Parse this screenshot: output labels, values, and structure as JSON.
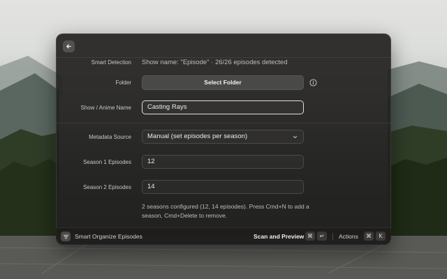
{
  "smart_detection": {
    "label": "Smart Detection",
    "value": "Show name: \"Episode\" · 26/26 episodes detected"
  },
  "folder": {
    "label": "Folder",
    "button_label": "Select Folder",
    "info_icon": "info-circle-icon"
  },
  "show_name": {
    "label": "Show / Anime Name",
    "value": "Casting Rays"
  },
  "metadata_source": {
    "label": "Metadata Source",
    "selected": "Manual (set episodes per season)"
  },
  "season1": {
    "label": "Season 1 Episodes",
    "value": "12"
  },
  "season2": {
    "label": "Season 2 Episodes",
    "value": "14"
  },
  "help_text": "2 seasons configured (12, 14 episodes). Press Cmd+N to add a season, Cmd+Delete to remove.",
  "footer": {
    "app_icon": "filter-lines-icon",
    "title": "Smart Organize Episodes",
    "primary_action": "Scan and Preview",
    "primary_shortcut": [
      "⌘",
      "↵"
    ],
    "actions_label": "Actions",
    "actions_shortcut": [
      "⌘",
      "K"
    ]
  },
  "colors": {
    "window_bg": "#222120",
    "accent_text": "#f2f2f2",
    "muted_text": "#bdbdbd"
  }
}
